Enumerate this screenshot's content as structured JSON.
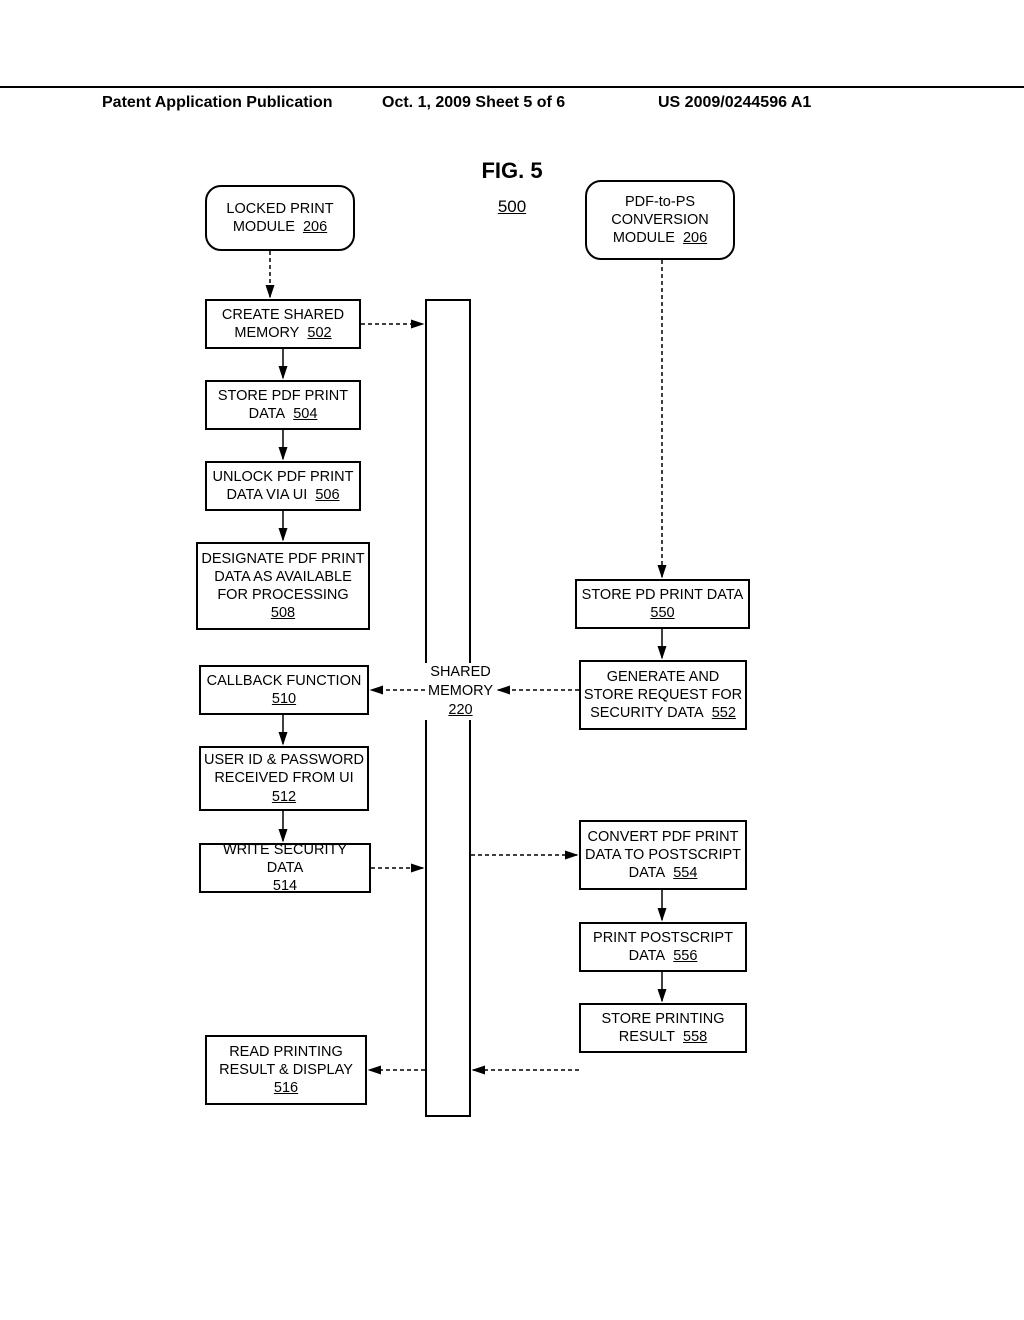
{
  "header": {
    "left": "Patent Application Publication",
    "mid": "Oct. 1, 2009   Sheet 5 of 6",
    "right": "US 2009/0244596 A1"
  },
  "fig": {
    "title": "FIG. 5",
    "num": "500"
  },
  "boxes": {
    "locked_print": {
      "l1": "LOCKED PRINT",
      "l2": "MODULE",
      "n": "206"
    },
    "pdf_to_ps": {
      "l1": "PDF-to-PS",
      "l2": "CONVERSION",
      "l3": "MODULE",
      "n": "206"
    },
    "create_shared": {
      "l1": "CREATE SHARED",
      "l2": "MEMORY",
      "n": "502"
    },
    "store_pdf": {
      "l1": "STORE PDF PRINT",
      "l2": "DATA",
      "n": "504"
    },
    "unlock": {
      "l1": "UNLOCK PDF PRINT",
      "l2": "DATA VIA UI",
      "n": "506"
    },
    "designate": {
      "l1": "DESIGNATE PDF PRINT",
      "l2": "DATA AS AVAILABLE",
      "l3": "FOR PROCESSING",
      "n": "508"
    },
    "callback": {
      "l1": "CALLBACK FUNCTION",
      "n": "510"
    },
    "userid": {
      "l1": "USER ID & PASSWORD",
      "l2": "RECEIVED FROM UI",
      "n": "512"
    },
    "write_sec": {
      "l1": "WRITE SECURITY DATA",
      "n": "514"
    },
    "read_print": {
      "l1": "READ PRINTING",
      "l2": "RESULT & DISPLAY",
      "n": "516"
    },
    "shared_mem": {
      "l1": "SHARED",
      "l2": "MEMORY",
      "n": "220"
    },
    "store_pd": {
      "l1": "STORE PD PRINT DATA",
      "n": "550"
    },
    "gen_req": {
      "l1": "GENERATE AND",
      "l2": "STORE REQUEST FOR",
      "l3": "SECURITY DATA",
      "n": "552"
    },
    "convert": {
      "l1": "CONVERT PDF PRINT",
      "l2": "DATA TO POSTSCRIPT",
      "l3": "DATA",
      "n": "554"
    },
    "print_ps": {
      "l1": "PRINT POSTSCRIPT",
      "l2": "DATA",
      "n": "556"
    },
    "store_result": {
      "l1": "STORE PRINTING",
      "l2": "RESULT",
      "n": "558"
    }
  },
  "chart_data": {
    "type": "diagram",
    "title": "FIG. 5",
    "ref": "500",
    "participants": [
      {
        "id": "locked_print",
        "label": "LOCKED PRINT MODULE 206",
        "column": "left"
      },
      {
        "id": "shared_memory",
        "label": "SHARED MEMORY 220",
        "column": "center"
      },
      {
        "id": "pdf_to_ps",
        "label": "PDF-to-PS CONVERSION MODULE 206",
        "column": "right"
      }
    ],
    "left_steps": [
      {
        "label": "CREATE SHARED MEMORY",
        "ref": "502"
      },
      {
        "label": "STORE PDF PRINT DATA",
        "ref": "504"
      },
      {
        "label": "UNLOCK PDF PRINT DATA VIA UI",
        "ref": "506"
      },
      {
        "label": "DESIGNATE PDF PRINT DATA AS AVAILABLE FOR PROCESSING",
        "ref": "508"
      },
      {
        "label": "CALLBACK FUNCTION",
        "ref": "510"
      },
      {
        "label": "USER ID & PASSWORD RECEIVED FROM UI",
        "ref": "512"
      },
      {
        "label": "WRITE SECURITY DATA",
        "ref": "514"
      },
      {
        "label": "READ PRINTING RESULT & DISPLAY",
        "ref": "516"
      }
    ],
    "right_steps": [
      {
        "label": "STORE PD PRINT DATA",
        "ref": "550"
      },
      {
        "label": "GENERATE AND STORE REQUEST FOR SECURITY DATA",
        "ref": "552"
      },
      {
        "label": "CONVERT PDF PRINT DATA TO POSTSCRIPT DATA",
        "ref": "554"
      },
      {
        "label": "PRINT POSTSCRIPT DATA",
        "ref": "556"
      },
      {
        "label": "STORE PRINTING RESULT",
        "ref": "558"
      }
    ],
    "messages": [
      {
        "from": "locked_print",
        "to": "502",
        "style": "dashed"
      },
      {
        "from": "pdf_to_ps",
        "to": "550",
        "style": "dashed"
      },
      {
        "from": "502",
        "to": "shared_memory",
        "style": "dashed"
      },
      {
        "from": "502",
        "to": "504",
        "style": "solid"
      },
      {
        "from": "504",
        "to": "506",
        "style": "solid"
      },
      {
        "from": "506",
        "to": "508",
        "style": "solid"
      },
      {
        "from": "shared_memory",
        "to": "510",
        "style": "dashed"
      },
      {
        "from": "552",
        "to": "shared_memory",
        "style": "dashed"
      },
      {
        "from": "510",
        "to": "512",
        "style": "solid"
      },
      {
        "from": "512",
        "to": "514",
        "style": "solid"
      },
      {
        "from": "514",
        "to": "shared_memory",
        "style": "dashed"
      },
      {
        "from": "shared_memory",
        "to": "554",
        "style": "dashed"
      },
      {
        "from": "550",
        "to": "552",
        "style": "solid"
      },
      {
        "from": "554",
        "to": "556",
        "style": "solid"
      },
      {
        "from": "556",
        "to": "558",
        "style": "solid"
      },
      {
        "from": "558",
        "to": "shared_memory",
        "style": "dashed"
      },
      {
        "from": "shared_memory",
        "to": "516",
        "style": "dashed"
      }
    ]
  }
}
